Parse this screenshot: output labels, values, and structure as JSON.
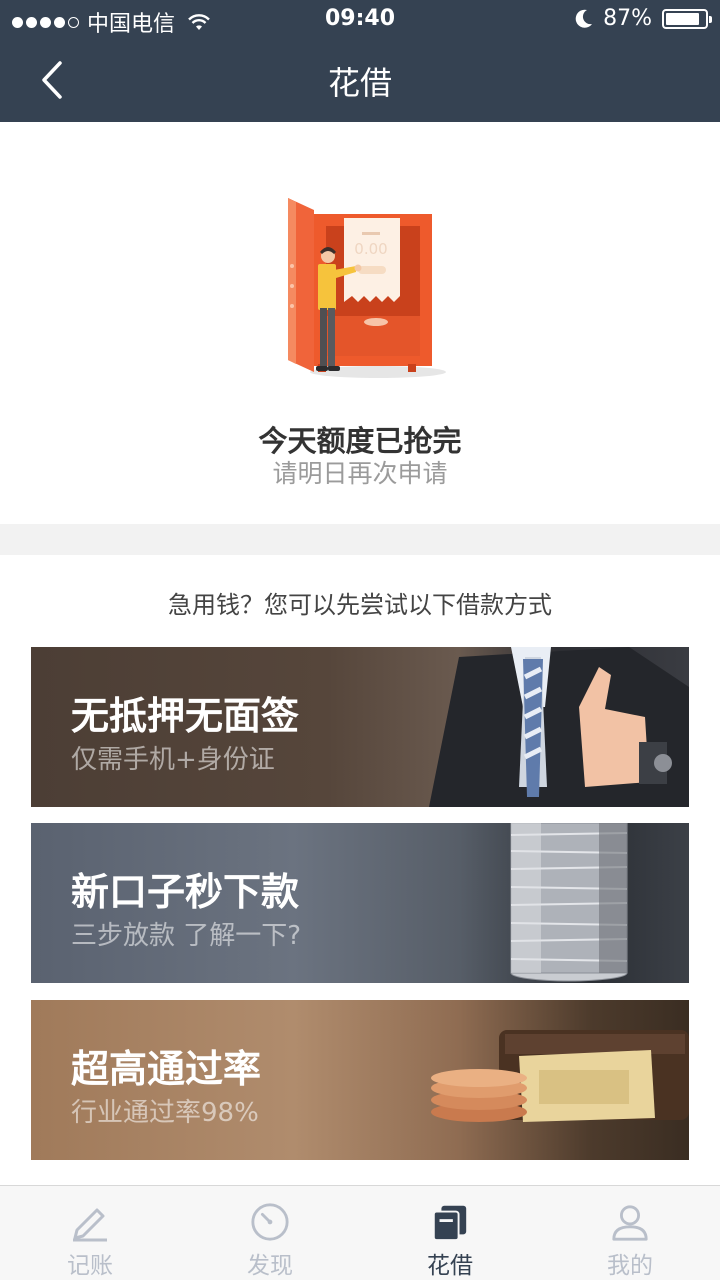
{
  "status_bar": {
    "carrier": "中国电信",
    "time": "09:40",
    "battery": "87%"
  },
  "navbar": {
    "title": "花借"
  },
  "hero": {
    "title": "今天额度已抢完",
    "subtitle": "请明日再次申请",
    "illustration_amount": "0.00"
  },
  "alternatives": {
    "heading": "急用钱？您可以先尝试以下借款方式",
    "banners": [
      {
        "title": "无抵押无面签",
        "subtitle": "仅需手机+身份证"
      },
      {
        "title": "新口子秒下款",
        "subtitle": "三步放款 了解一下?"
      },
      {
        "title": "超高通过率",
        "subtitle": "行业通过率98%"
      }
    ]
  },
  "tabbar": {
    "tabs": [
      {
        "label": "记账",
        "icon": "pencil-icon",
        "active": false
      },
      {
        "label": "发现",
        "icon": "compass-icon",
        "active": false
      },
      {
        "label": "花借",
        "icon": "cards-icon",
        "active": true
      },
      {
        "label": "我的",
        "icon": "user-icon",
        "active": false
      }
    ]
  },
  "colors": {
    "header_bg": "#354252",
    "accent_orange": "#e8572a",
    "tab_inactive": "#b9bfca"
  }
}
